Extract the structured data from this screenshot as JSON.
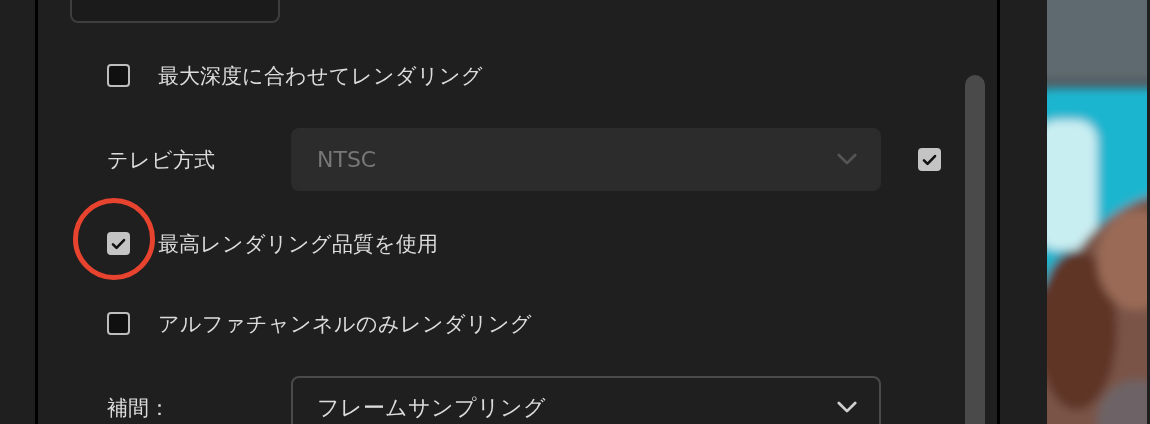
{
  "settings": [
    {
      "kind": "checkbox",
      "label": "最大深度に合わせてレンダリング",
      "checked": false,
      "highlighted": false
    },
    {
      "kind": "dropdown",
      "label": "テレビ方式",
      "value": "NTSC",
      "disabled": true,
      "side_checkbox": {
        "checked": true
      }
    },
    {
      "kind": "checkbox",
      "label": "最高レンダリング品質を使用",
      "checked": true,
      "highlighted": true
    },
    {
      "kind": "checkbox",
      "label": "アルファチャンネルのみレンダリング",
      "checked": false,
      "highlighted": false
    },
    {
      "kind": "dropdown",
      "label": "補間：",
      "value": "フレームサンプリング",
      "disabled": false
    }
  ]
}
